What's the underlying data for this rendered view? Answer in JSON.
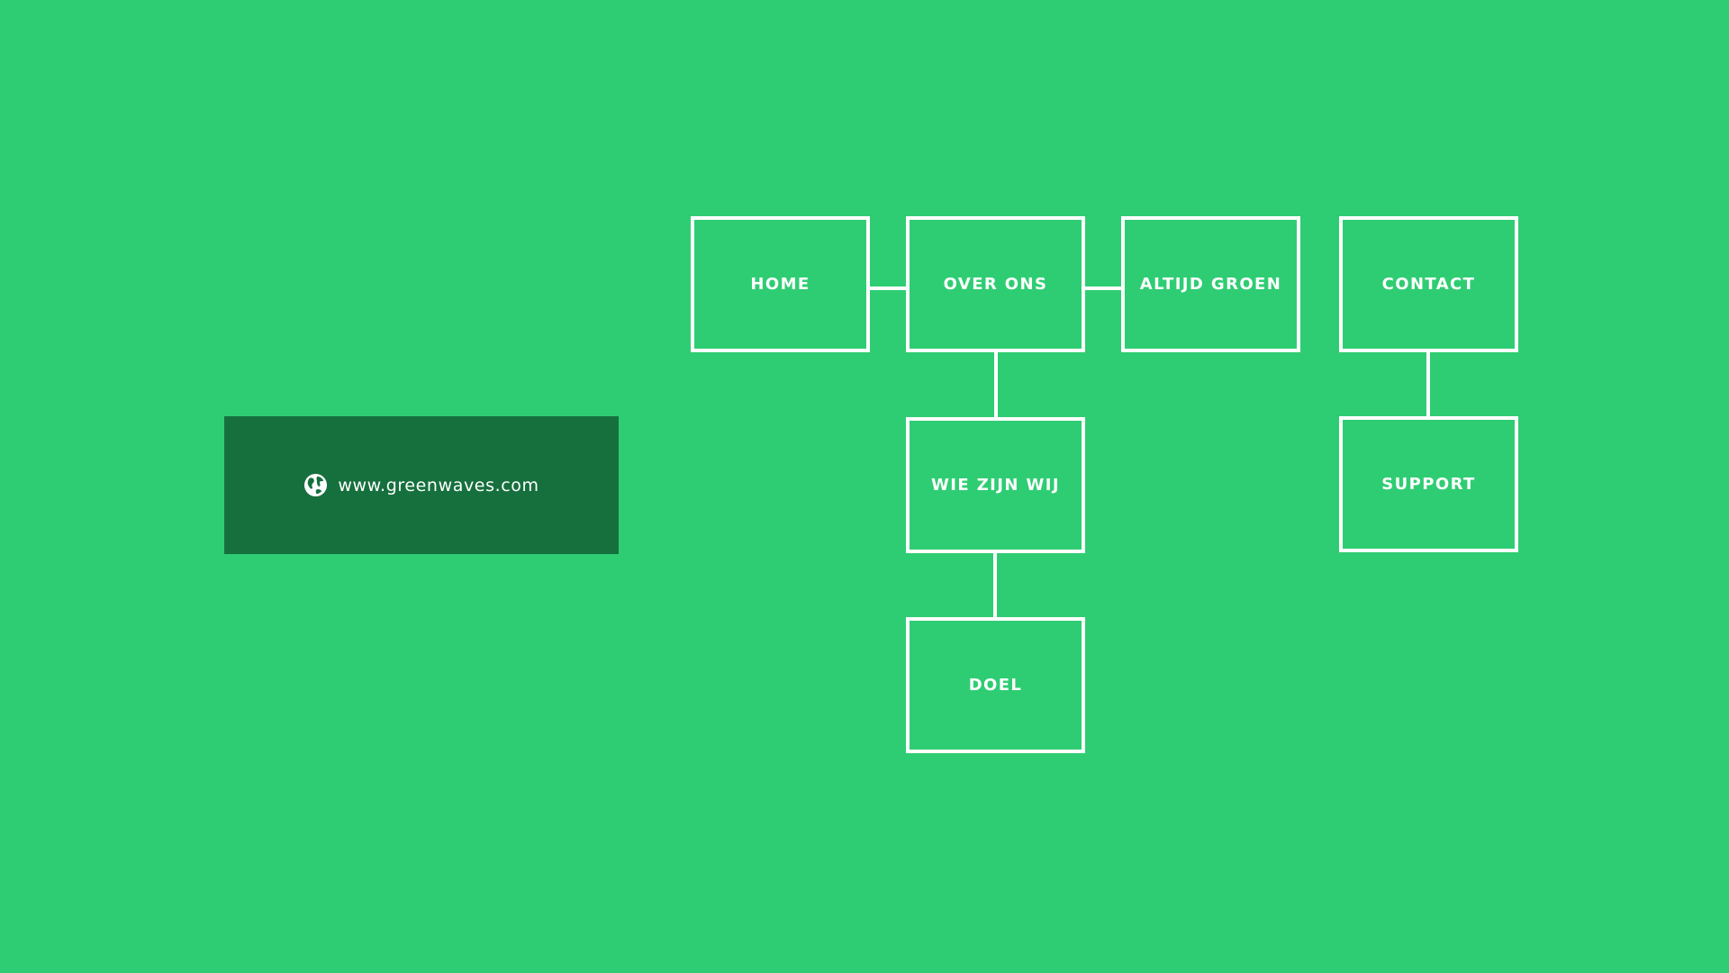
{
  "url": {
    "icon": "globe-icon",
    "text": "www.greenwaves.com"
  },
  "nodes": {
    "home": "HOME",
    "over_ons": "OVER ONS",
    "altijd_groen": "ALTIJD GROEN",
    "contact": "CONTACT",
    "wie_zijn_wij": "WIE ZIJN WIJ",
    "doel": "DOEL",
    "support": "SUPPORT"
  },
  "colors": {
    "background": "#2fcd73",
    "url_box": "#16703e",
    "line": "#ffffff"
  }
}
